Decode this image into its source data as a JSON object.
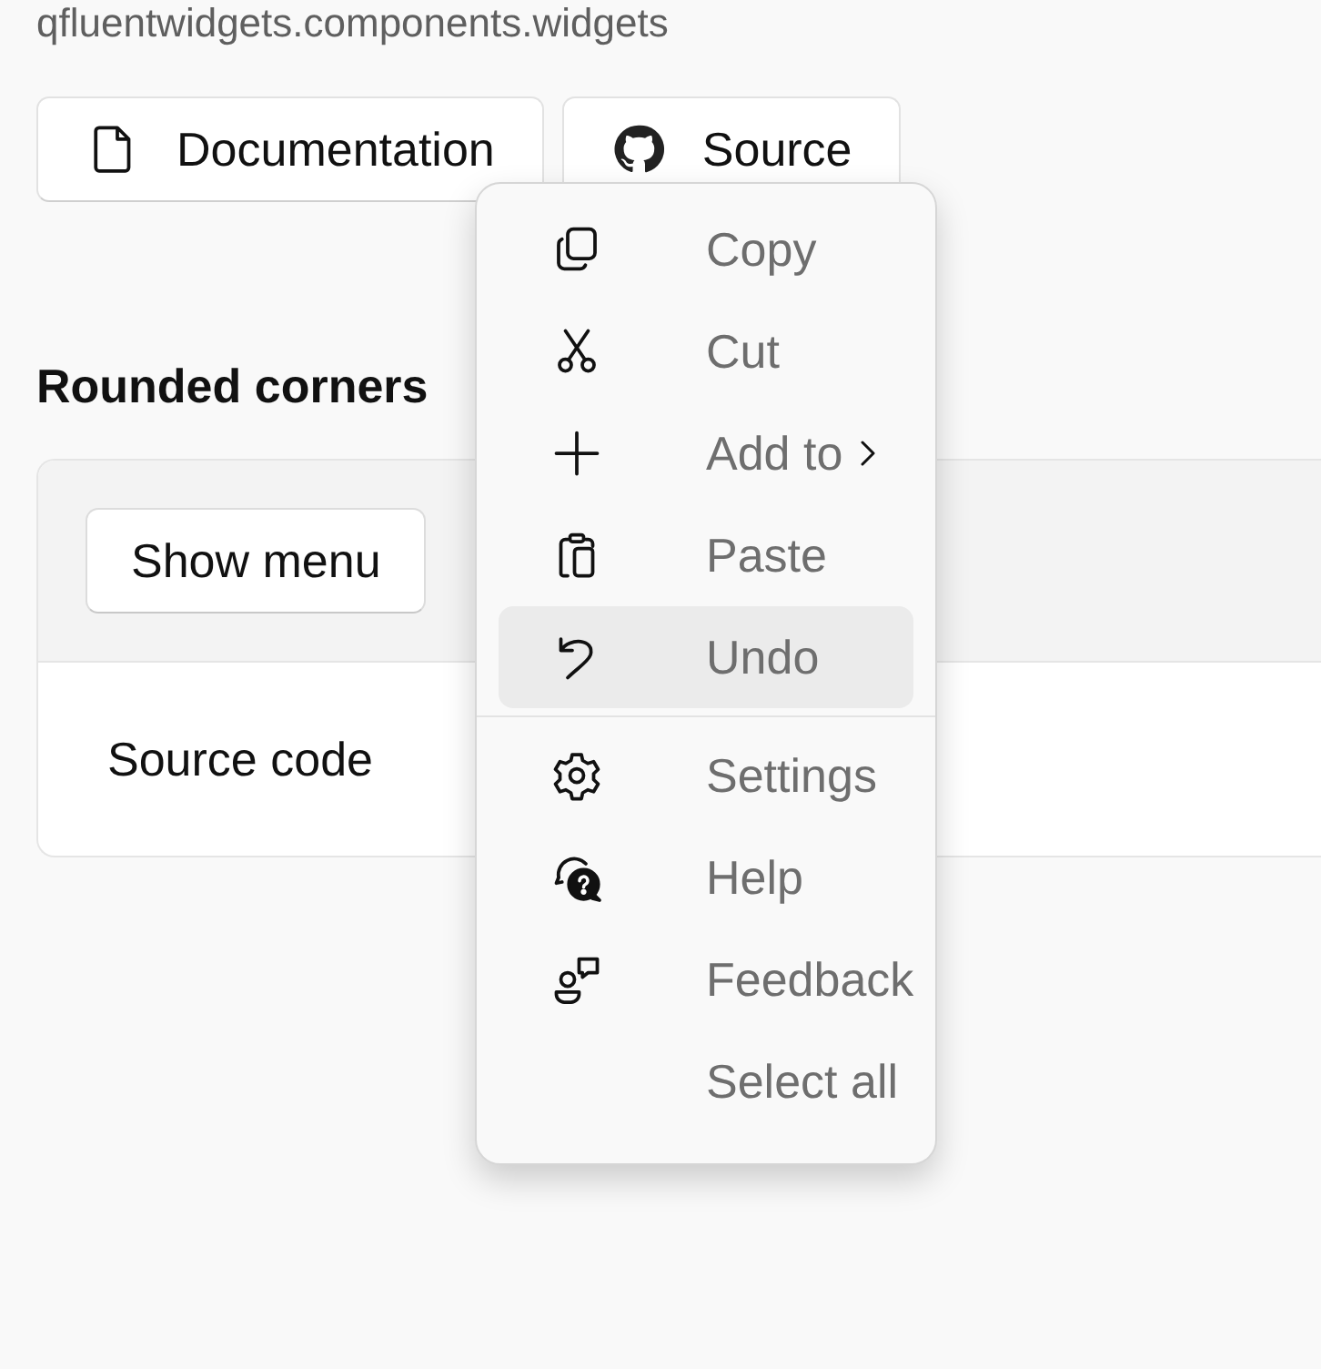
{
  "module_path": "qfluentwidgets.components.widgets",
  "links": [
    {
      "label": "Documentation",
      "kind": "doc"
    },
    {
      "label": "Source",
      "kind": "github"
    }
  ],
  "section_title": "Rounded corners",
  "card": {
    "button": "Show menu",
    "footer": "Source code"
  },
  "menu": {
    "groups": [
      [
        {
          "label": "Copy",
          "submenu": false,
          "selected": false
        },
        {
          "label": "Cut",
          "submenu": false,
          "selected": false
        },
        {
          "label": "Add to",
          "submenu": true,
          "selected": false
        },
        {
          "label": "Paste",
          "submenu": false,
          "selected": false
        },
        {
          "label": "Undo",
          "submenu": false,
          "selected": true
        }
      ],
      [
        {
          "label": "Settings",
          "submenu": false,
          "selected": false
        },
        {
          "label": "Help",
          "submenu": false,
          "selected": false
        },
        {
          "label": "Feedback",
          "submenu": false,
          "selected": false
        },
        {
          "label": "Select all",
          "submenu": false,
          "selected": false
        }
      ]
    ]
  }
}
